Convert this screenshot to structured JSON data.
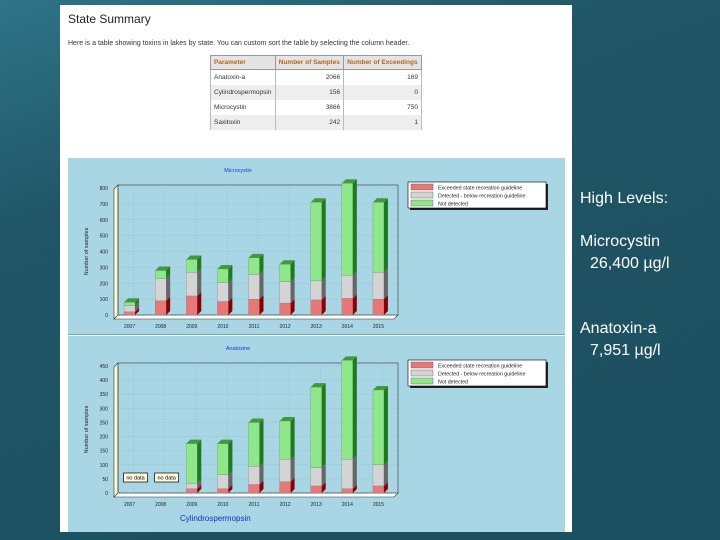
{
  "page": {
    "title": "State Summary",
    "intro": "Here is a table showing toxins in lakes by state. You can custom sort the table by selecting the column header."
  },
  "table": {
    "headers": [
      "Parameter",
      "Number of Samples",
      "Number of Exceedings"
    ],
    "rows": [
      [
        "Anatoxin-a",
        "2066",
        "169"
      ],
      [
        "Cylindrospermopsin",
        "156",
        "0"
      ],
      [
        "Microcystin",
        "3866",
        "750"
      ],
      [
        "Saxitoxin",
        "242",
        "1"
      ]
    ]
  },
  "legend": [
    "Exceeded state recreation guideline",
    "Detected - below recreation guideline",
    "Not detected"
  ],
  "colors": {
    "exceeded": "#e87878",
    "detected": "#d4d4d4",
    "not_detected": "#8ee88a",
    "panel": "#a9d6e5"
  },
  "chart_data": [
    {
      "type": "bar",
      "stacked": true,
      "title": "Microcystin",
      "ylabel": "Number of samples",
      "ylim": [
        0,
        800
      ],
      "yticks": [
        0,
        100,
        200,
        300,
        400,
        500,
        600,
        700,
        800
      ],
      "categories": [
        "2007",
        "2008",
        "2009",
        "2010",
        "2011",
        "2012",
        "2013",
        "2014",
        "2015"
      ],
      "series": [
        {
          "name": "Exceeded state recreation guideline",
          "values": [
            20,
            90,
            120,
            85,
            100,
            75,
            95,
            105,
            100
          ]
        },
        {
          "name": "Detected - below recreation guideline",
          "values": [
            40,
            140,
            150,
            120,
            155,
            135,
            120,
            145,
            170
          ]
        },
        {
          "name": "Not detected",
          "values": [
            20,
            50,
            80,
            85,
            105,
            110,
            495,
            580,
            440
          ]
        }
      ],
      "annotations": []
    },
    {
      "type": "bar",
      "stacked": true,
      "title": "Anatoxine",
      "ylabel": "Number of samples",
      "ylim": [
        0,
        450
      ],
      "yticks": [
        0,
        50,
        100,
        150,
        200,
        250,
        300,
        350,
        400,
        450
      ],
      "categories": [
        "2007",
        "2008",
        "2009",
        "2010",
        "2011",
        "2012",
        "2013",
        "2014",
        "2015"
      ],
      "series": [
        {
          "name": "Exceeded state recreation guideline",
          "values": [
            null,
            null,
            15,
            15,
            30,
            40,
            25,
            15,
            25
          ]
        },
        {
          "name": "Detected - below recreation guideline",
          "values": [
            null,
            null,
            20,
            50,
            65,
            80,
            65,
            105,
            75
          ]
        },
        {
          "name": "Not detected",
          "values": [
            null,
            null,
            140,
            110,
            155,
            135,
            285,
            350,
            265
          ]
        }
      ],
      "annotations": [
        "no data",
        "no data"
      ]
    }
  ],
  "next_chart_title": "Cylindrospermopsin",
  "side": {
    "heading": "High Levels:",
    "items": [
      {
        "name": "Microcystin",
        "value": "26,400 µg/l"
      },
      {
        "name": "Anatoxin-a",
        "value": "7,951 µg/l"
      }
    ]
  }
}
